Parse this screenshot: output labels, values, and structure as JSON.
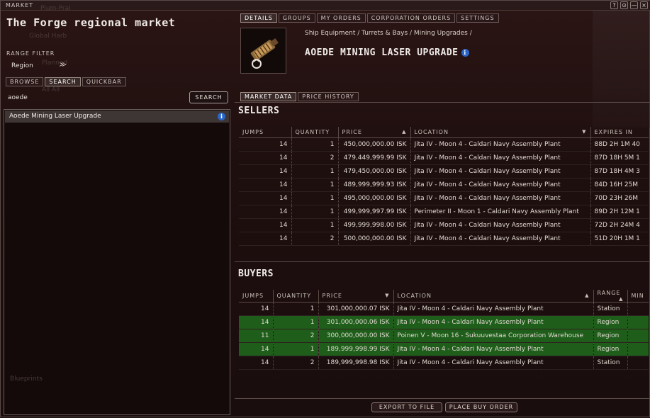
{
  "window": {
    "title": "MARKET",
    "controls": [
      "?",
      "⊙",
      "—",
      "×"
    ]
  },
  "left": {
    "region_title": "The Forge regional market",
    "ghost_lines": [
      "Plum-Pral",
      "Global Harb",
      "Planned",
      "All All",
      "Blueprints"
    ],
    "range_filter_label": "RANGE FILTER",
    "range_value": "Region",
    "tabs": [
      "BROWSE",
      "SEARCH",
      "QUICKBAR"
    ],
    "active_tab": "SEARCH",
    "search_value": "aoede",
    "search_button": "SEARCH",
    "results": [
      "Aoede Mining Laser Upgrade"
    ]
  },
  "right": {
    "tabs": [
      "DETAILS",
      "GROUPS",
      "MY ORDERS",
      "CORPORATION ORDERS",
      "SETTINGS"
    ],
    "active_tab": "DETAILS",
    "breadcrumb": "Ship Equipment / Turrets & Bays / Mining Upgrades /",
    "item_name": "AOEDE MINING LASER UPGRADE",
    "subtabs": [
      "MARKET DATA",
      "PRICE HISTORY"
    ],
    "active_subtab": "MARKET DATA",
    "sellers": {
      "title": "SELLERS",
      "columns": [
        "JUMPS",
        "QUANTITY",
        "PRICE",
        "LOCATION",
        "EXPIRES IN"
      ],
      "rows": [
        [
          "14",
          "1",
          "450,000,000.00 ISK",
          "Jita IV - Moon 4 - Caldari Navy Assembly Plant",
          "88D 2H 1M 40"
        ],
        [
          "14",
          "2",
          "479,449,999.99 ISK",
          "Jita IV - Moon 4 - Caldari Navy Assembly Plant",
          "87D 18H 5M 1"
        ],
        [
          "14",
          "1",
          "479,450,000.00 ISK",
          "Jita IV - Moon 4 - Caldari Navy Assembly Plant",
          "87D 18H 4M 3"
        ],
        [
          "14",
          "1",
          "489,999,999.93 ISK",
          "Jita IV - Moon 4 - Caldari Navy Assembly Plant",
          "84D 16H 25M"
        ],
        [
          "14",
          "1",
          "495,000,000.00 ISK",
          "Jita IV - Moon 4 - Caldari Navy Assembly Plant",
          "70D 23H 26M"
        ],
        [
          "14",
          "1",
          "499,999,997.99 ISK",
          "Perimeter II - Moon 1 - Caldari Navy Assembly Plant",
          "89D 2H 12M 1"
        ],
        [
          "14",
          "1",
          "499,999,998.00 ISK",
          "Jita IV - Moon 4 - Caldari Navy Assembly Plant",
          "72D 2H 24M 4"
        ],
        [
          "14",
          "2",
          "500,000,000.00 ISK",
          "Jita IV - Moon 4 - Caldari Navy Assembly Plant",
          "51D 20H 1M 1"
        ]
      ]
    },
    "buyers": {
      "title": "BUYERS",
      "columns": [
        "JUMPS",
        "QUANTITY",
        "PRICE",
        "LOCATION",
        "RANGE",
        "MIN"
      ],
      "rows": [
        [
          "14",
          "1",
          "301,000,000.07 ISK",
          "Jita IV - Moon 4 - Caldari Navy Assembly Plant",
          "Station",
          ""
        ],
        [
          "14",
          "1",
          "301,000,000.06 ISK",
          "Jita IV - Moon 4 - Caldari Navy Assembly Plant",
          "Region",
          ""
        ],
        [
          "11",
          "2",
          "300,000,000.00 ISK",
          "Poinen V - Moon 16 - Sukuuvestaa Corporation Warehouse",
          "Region",
          ""
        ],
        [
          "14",
          "1",
          "189,999,998.99 ISK",
          "Jita IV - Moon 4 - Caldari Navy Assembly Plant",
          "Region",
          ""
        ],
        [
          "14",
          "2",
          "189,999,998.98 ISK",
          "Jita IV - Moon 4 - Caldari Navy Assembly Plant",
          "Station",
          ""
        ]
      ],
      "highlighted_rows": [
        1,
        2,
        3
      ]
    },
    "buttons": {
      "export": "EXPORT TO FILE",
      "place_buy": "PLACE BUY ORDER"
    }
  },
  "colors": {
    "highlight_green": "#1e5e1a",
    "info_blue": "#2a66c8",
    "background": "#1e0f0f"
  }
}
